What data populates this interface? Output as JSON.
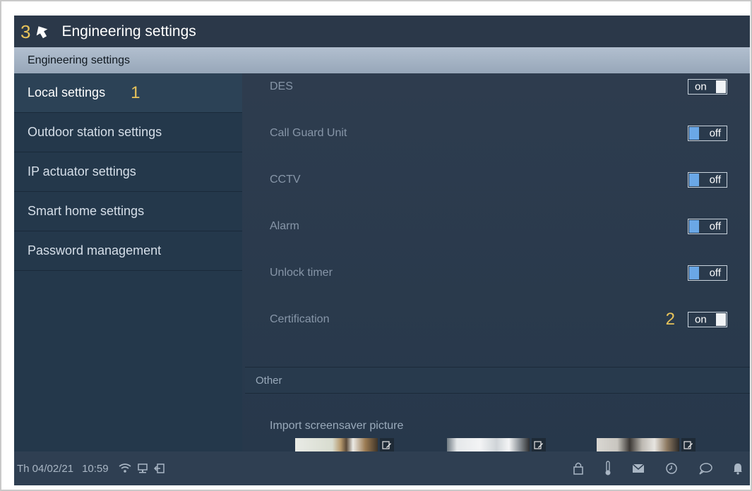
{
  "header": {
    "number": "3",
    "title": "Engineering settings"
  },
  "section": {
    "title": "Engineering settings"
  },
  "sidebar": {
    "items": [
      {
        "label": "Local settings",
        "number": "1"
      },
      {
        "label": "Outdoor station settings"
      },
      {
        "label": "IP actuator settings"
      },
      {
        "label": "Smart home settings"
      },
      {
        "label": "Password management"
      }
    ]
  },
  "settings": {
    "rows": [
      {
        "label": "DES",
        "state": "on"
      },
      {
        "label": "Call Guard Unit",
        "state": "off"
      },
      {
        "label": "CCTV",
        "state": "off"
      },
      {
        "label": "Alarm",
        "state": "off"
      },
      {
        "label": "Unlock timer",
        "state": "off"
      },
      {
        "label": "Certification",
        "state": "on",
        "number": "2"
      }
    ]
  },
  "other": {
    "title": "Other",
    "import_label": "Import screensaver picture"
  },
  "status": {
    "date": "Th 04/02/21",
    "time": "10:59",
    "left_icons": [
      "wifi-icon",
      "network-icon",
      "logout-icon"
    ],
    "right_icons": [
      "lock-icon",
      "thermometer-icon",
      "mail-icon",
      "history-icon",
      "chat-icon",
      "bell-icon"
    ]
  },
  "colors": {
    "accent_number": "#e8c35a",
    "toggle_knob_off": "#6aa7e6",
    "background": "#27384b"
  }
}
